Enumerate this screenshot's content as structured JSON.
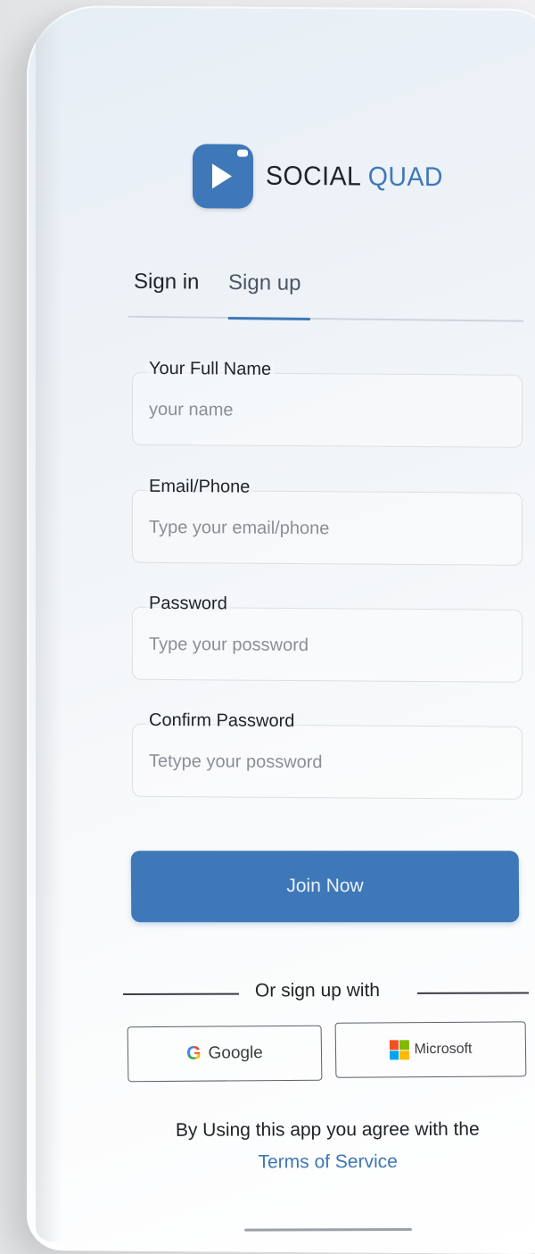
{
  "brand": {
    "name_part1": "SOCIAL",
    "name_part2": "QUAD",
    "logo_icon": "play-icon",
    "accent_color": "#3f78b8"
  },
  "tabs": [
    {
      "label": "Sign in",
      "active": false
    },
    {
      "label": "Sign up",
      "active": true
    }
  ],
  "form": {
    "fields": [
      {
        "label": "Your Full Name",
        "placeholder": "your name",
        "value": ""
      },
      {
        "label": "Email/Phone",
        "placeholder": "Type your email/phone",
        "value": ""
      },
      {
        "label": "Password",
        "placeholder": "Type your possword",
        "value": ""
      },
      {
        "label": "Confirm Password",
        "placeholder": "Tetype your possword",
        "value": ""
      }
    ],
    "submit_label": "Join Now"
  },
  "social": {
    "divider_text": "Or sign up with",
    "google_label": "Google",
    "google_icon": "google-icon",
    "microsoft_label": "Microsoft",
    "microsoft_icon": "microsoft-icon"
  },
  "footer": {
    "agreement_text": "By Using this app you agree with the",
    "terms_link": "Terms of Service"
  }
}
